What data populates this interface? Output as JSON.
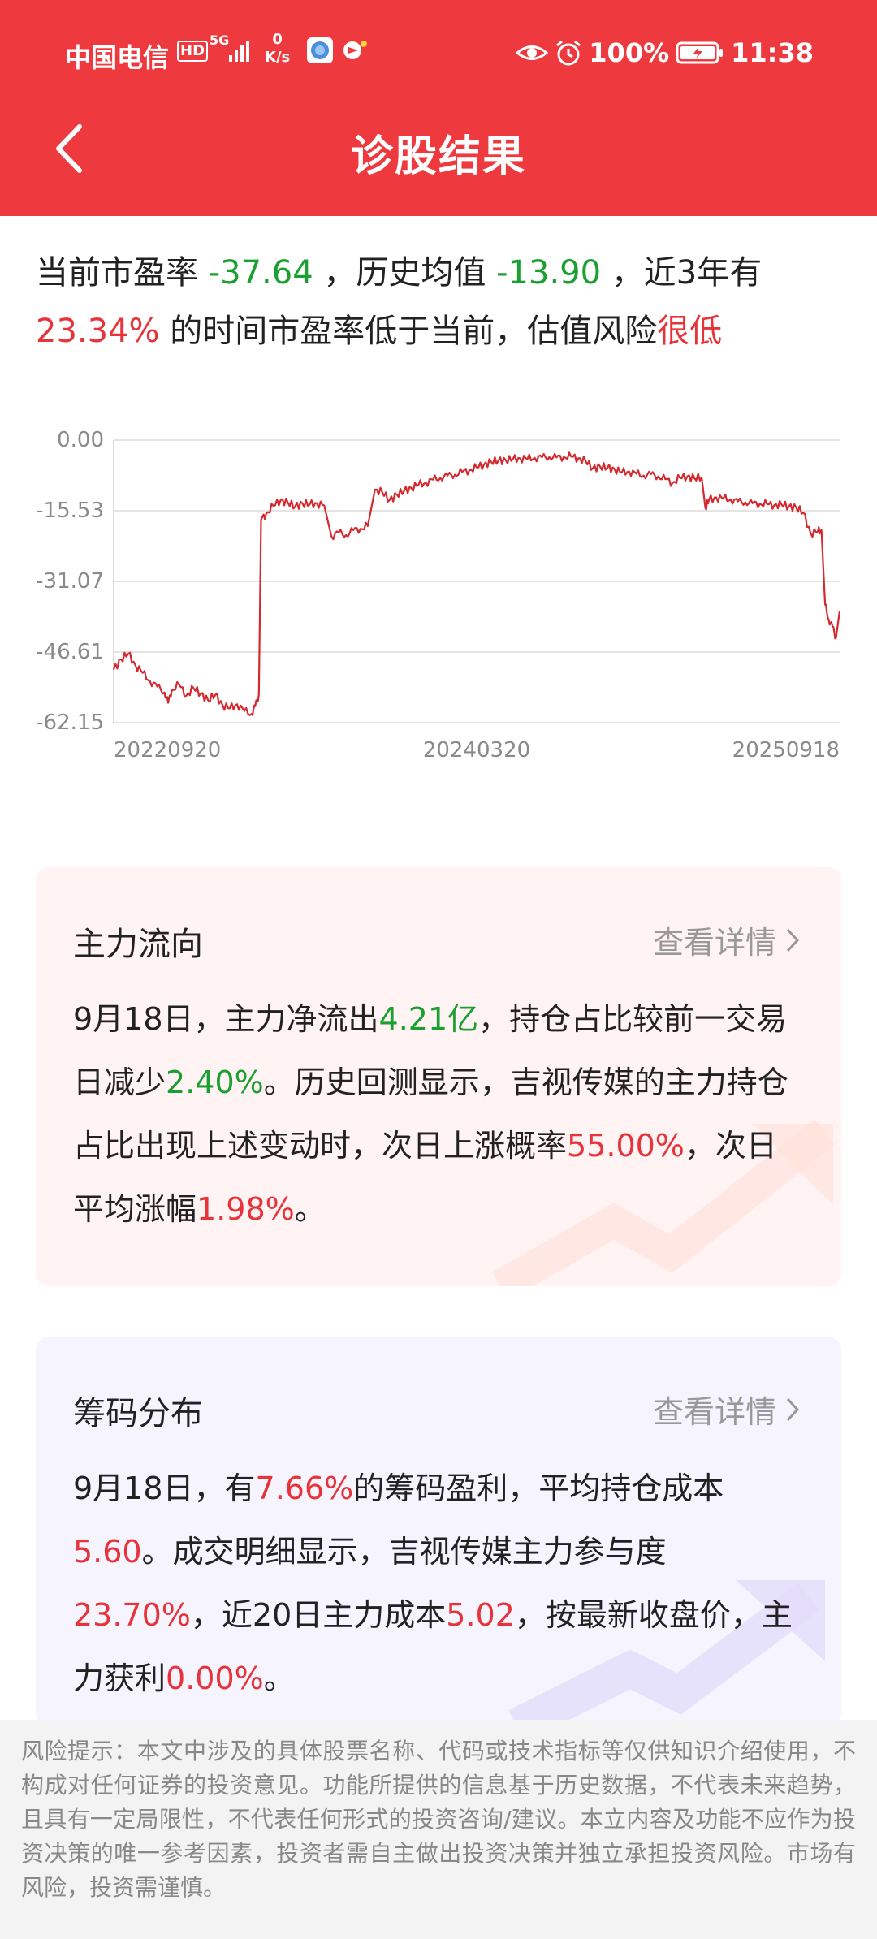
{
  "status_bar": {
    "carrier": "中国电信",
    "hd": "HD",
    "net": "5G",
    "speed_value": "0",
    "speed_unit": "K/s",
    "battery": "100%",
    "time": "11:38"
  },
  "header": {
    "title": "诊股结果"
  },
  "summary": {
    "p1": "当前市盈率 ",
    "pe_current": "-37.64",
    "p2": " ，历史均值 ",
    "pe_avg": "-13.90",
    "p3": " ，近3年有",
    "percent_low": "23.34%",
    "p4": " 的时间市盈率低于当前，估值风险",
    "risk_level": "很低"
  },
  "chart_data": {
    "type": "line",
    "y_tick_labels": [
      "0.00",
      "-15.53",
      "-31.07",
      "-46.61",
      "-62.15"
    ],
    "x_tick_labels": [
      "20220920",
      "20240320",
      "20250918"
    ],
    "ylim": [
      -62.15,
      0
    ],
    "grid": true,
    "line_color": "#d42a2f",
    "points": [
      [
        0,
        -50.5
      ],
      [
        0.01,
        -48.2
      ],
      [
        0.02,
        -47.0
      ],
      [
        0.03,
        -49.5
      ],
      [
        0.04,
        -51.2
      ],
      [
        0.05,
        -53.0
      ],
      [
        0.06,
        -54.2
      ],
      [
        0.07,
        -55.5
      ],
      [
        0.075,
        -57.8
      ],
      [
        0.08,
        -55.0
      ],
      [
        0.09,
        -53.8
      ],
      [
        0.1,
        -56.2
      ],
      [
        0.11,
        -54.5
      ],
      [
        0.12,
        -55.8
      ],
      [
        0.13,
        -57.2
      ],
      [
        0.14,
        -56.0
      ],
      [
        0.15,
        -58.3
      ],
      [
        0.16,
        -59.0
      ],
      [
        0.17,
        -58.1
      ],
      [
        0.18,
        -59.6
      ],
      [
        0.19,
        -60.2
      ],
      [
        0.195,
        -58.5
      ],
      [
        0.2,
        -56.0
      ],
      [
        0.203,
        -17.5
      ],
      [
        0.21,
        -16.2
      ],
      [
        0.22,
        -14.5
      ],
      [
        0.23,
        -13.2
      ],
      [
        0.24,
        -13.8
      ],
      [
        0.25,
        -14.6
      ],
      [
        0.26,
        -13.9
      ],
      [
        0.27,
        -14.2
      ],
      [
        0.28,
        -13.9
      ],
      [
        0.29,
        -14.4
      ],
      [
        0.3,
        -21.2
      ],
      [
        0.31,
        -20.3
      ],
      [
        0.32,
        -20.9
      ],
      [
        0.33,
        -19.8
      ],
      [
        0.34,
        -19.5
      ],
      [
        0.35,
        -18.9
      ],
      [
        0.36,
        -10.9
      ],
      [
        0.37,
        -11.5
      ],
      [
        0.38,
        -13.2
      ],
      [
        0.39,
        -12.0
      ],
      [
        0.4,
        -11.2
      ],
      [
        0.41,
        -10.5
      ],
      [
        0.42,
        -9.8
      ],
      [
        0.43,
        -9.4
      ],
      [
        0.44,
        -8.7
      ],
      [
        0.45,
        -8.3
      ],
      [
        0.46,
        -7.8
      ],
      [
        0.47,
        -7.6
      ],
      [
        0.48,
        -7.0
      ],
      [
        0.49,
        -6.6
      ],
      [
        0.5,
        -6.0
      ],
      [
        0.51,
        -5.4
      ],
      [
        0.52,
        -4.8
      ],
      [
        0.53,
        -4.5
      ],
      [
        0.54,
        -4.4
      ],
      [
        0.55,
        -4.2
      ],
      [
        0.56,
        -4.0
      ],
      [
        0.57,
        -4.1
      ],
      [
        0.58,
        -3.9
      ],
      [
        0.59,
        -3.8
      ],
      [
        0.6,
        -3.7
      ],
      [
        0.61,
        -3.8
      ],
      [
        0.62,
        -3.7
      ],
      [
        0.63,
        -3.6
      ],
      [
        0.64,
        -4.0
      ],
      [
        0.65,
        -4.6
      ],
      [
        0.66,
        -6.2
      ],
      [
        0.67,
        -5.8
      ],
      [
        0.68,
        -6.1
      ],
      [
        0.69,
        -6.4
      ],
      [
        0.7,
        -7.1
      ],
      [
        0.71,
        -6.9
      ],
      [
        0.72,
        -7.4
      ],
      [
        0.73,
        -7.8
      ],
      [
        0.74,
        -7.5
      ],
      [
        0.75,
        -8.0
      ],
      [
        0.76,
        -8.6
      ],
      [
        0.77,
        -9.4
      ],
      [
        0.78,
        -8.3
      ],
      [
        0.79,
        -8.0
      ],
      [
        0.8,
        -8.4
      ],
      [
        0.81,
        -8.2
      ],
      [
        0.815,
        -14.9
      ],
      [
        0.82,
        -13.2
      ],
      [
        0.83,
        -12.6
      ],
      [
        0.84,
        -12.8
      ],
      [
        0.85,
        -13.1
      ],
      [
        0.86,
        -13.5
      ],
      [
        0.87,
        -13.7
      ],
      [
        0.88,
        -13.9
      ],
      [
        0.89,
        -14.0
      ],
      [
        0.9,
        -14.1
      ],
      [
        0.91,
        -14.3
      ],
      [
        0.92,
        -14.2
      ],
      [
        0.93,
        -14.6
      ],
      [
        0.94,
        -14.8
      ],
      [
        0.95,
        -16.0
      ],
      [
        0.96,
        -20.5
      ],
      [
        0.97,
        -20.1
      ],
      [
        0.975,
        -19.8
      ],
      [
        0.98,
        -36.2
      ],
      [
        0.985,
        -39.5
      ],
      [
        0.99,
        -41.0
      ],
      [
        0.995,
        -43.5
      ],
      [
        1.0,
        -37.6
      ]
    ]
  },
  "card_flow": {
    "title": "主力流向",
    "more": "查看详情",
    "t1": "9月18日，主力净流出",
    "v1": "4.21亿",
    "t2": "，持仓占比较前一交易日减少",
    "v2": "2.40%",
    "t3": "。历史回测显示，吉视传媒的主力持仓占比出现上述变动时，次日上涨概率",
    "v3": "55.00%",
    "t4": "，次日平均涨幅",
    "v4": "1.98%",
    "t5": "。"
  },
  "card_chips": {
    "title": "筹码分布",
    "more": "查看详情",
    "t1": "9月18日，有",
    "v1": "7.66%",
    "t2": "的筹码盈利，平均持仓成本",
    "v2": "5.60",
    "t3": "。成交明细显示，吉视传媒主力参与度",
    "v3": "23.70%",
    "t4": "，近20日主力成本",
    "v4": "5.02",
    "t5": "，按最新收盘价，主力获利",
    "v5": "0.00%",
    "t6": "。"
  },
  "disclaimer": "风险提示：本文中涉及的具体股票名称、代码或技术指标等仅供知识介绍使用，不构成对任何证券的投资意见。功能所提供的信息基于历史数据，不代表未来趋势，且具有一定局限性，不代表任何形式的投资咨询/建议。本立内容及功能不应作为投资决策的唯一参考因素，投资者需自主做出投资决策并独立承担投资风险。市场有风险，投资需谨慎。"
}
